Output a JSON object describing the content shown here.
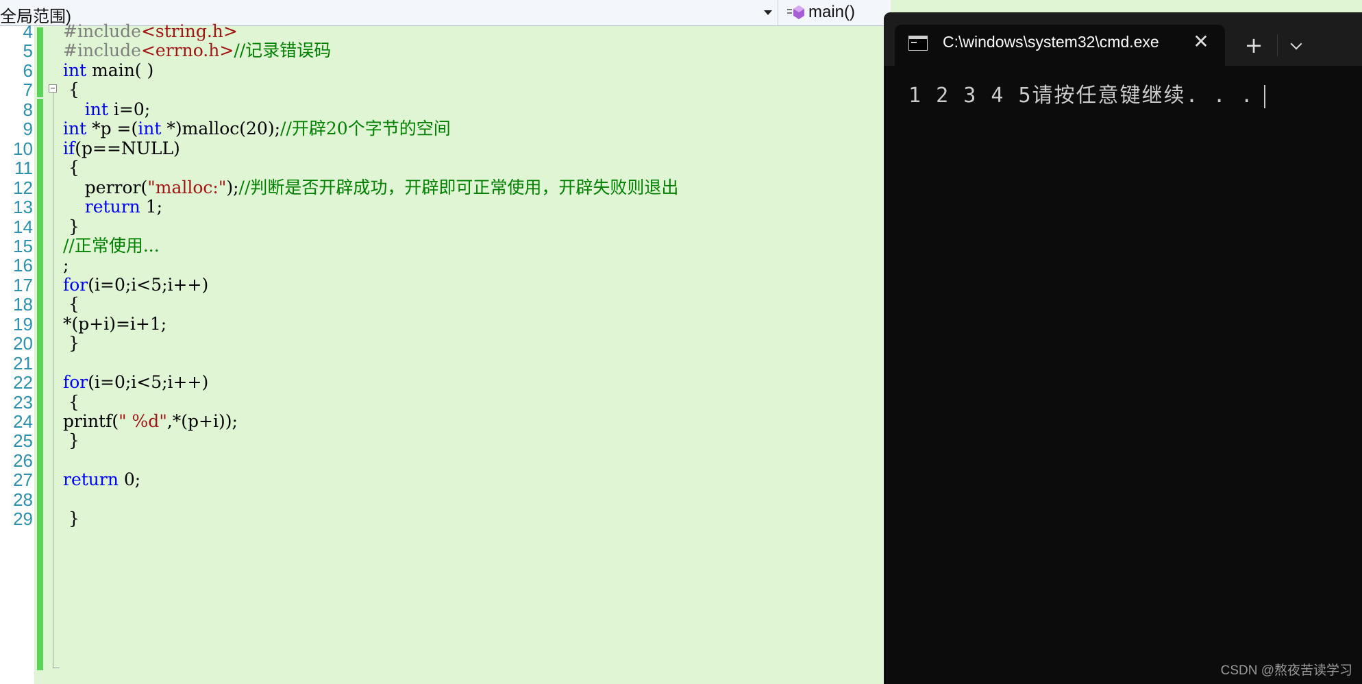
{
  "scope_bar": {
    "scope_text": "全局范围)",
    "member_text": "main()"
  },
  "editor": {
    "lines": [
      {
        "n": "4",
        "parts": [
          [
            "pp",
            "#include"
          ],
          [
            "str",
            "<string.h>"
          ]
        ]
      },
      {
        "n": "5",
        "parts": [
          [
            "pp",
            "#include"
          ],
          [
            "str",
            "<errno.h>"
          ],
          [
            "cm",
            "//记录错误码"
          ]
        ]
      },
      {
        "n": "6",
        "parts": [
          [
            "kw",
            "int"
          ],
          [
            "t",
            " main( )"
          ]
        ]
      },
      {
        "n": "7",
        "parts": [
          [
            "t",
            " {"
          ]
        ]
      },
      {
        "n": "8",
        "parts": [
          [
            "t",
            "    "
          ],
          [
            "kw",
            "int"
          ],
          [
            "t",
            " i=0;"
          ]
        ]
      },
      {
        "n": "9",
        "parts": [
          [
            "kw",
            "int"
          ],
          [
            "t",
            " *p =("
          ],
          [
            "kw",
            "int"
          ],
          [
            "t",
            " *)malloc(20);"
          ],
          [
            "cm",
            "//开辟20个字节的空间"
          ]
        ]
      },
      {
        "n": "10",
        "parts": [
          [
            "kw",
            "if"
          ],
          [
            "t",
            "(p==NULL)"
          ]
        ]
      },
      {
        "n": "11",
        "parts": [
          [
            "t",
            " {"
          ]
        ]
      },
      {
        "n": "12",
        "parts": [
          [
            "t",
            "    perror("
          ],
          [
            "str",
            "\"malloc:\""
          ],
          [
            "t",
            ");"
          ],
          [
            "cm",
            "//判断是否开辟成功，开辟即可正常使用，开辟失败则退出"
          ]
        ]
      },
      {
        "n": "13",
        "parts": [
          [
            "t",
            "    "
          ],
          [
            "kw",
            "return"
          ],
          [
            "t",
            " 1;"
          ]
        ]
      },
      {
        "n": "14",
        "parts": [
          [
            "t",
            " }"
          ]
        ]
      },
      {
        "n": "15",
        "parts": [
          [
            "cm",
            "//正常使用..."
          ]
        ]
      },
      {
        "n": "16",
        "parts": [
          [
            "t",
            ";"
          ]
        ]
      },
      {
        "n": "17",
        "parts": [
          [
            "kw",
            "for"
          ],
          [
            "t",
            "(i=0;i<5;i++)"
          ]
        ]
      },
      {
        "n": "18",
        "parts": [
          [
            "t",
            " {"
          ]
        ]
      },
      {
        "n": "19",
        "parts": [
          [
            "t",
            "*(p+i)=i+1;"
          ]
        ]
      },
      {
        "n": "20",
        "parts": [
          [
            "t",
            " }"
          ]
        ]
      },
      {
        "n": "21",
        "parts": []
      },
      {
        "n": "22",
        "parts": [
          [
            "kw",
            "for"
          ],
          [
            "t",
            "(i=0;i<5;i++)"
          ]
        ]
      },
      {
        "n": "23",
        "parts": [
          [
            "t",
            " {"
          ]
        ]
      },
      {
        "n": "24",
        "parts": [
          [
            "t",
            "printf("
          ],
          [
            "str",
            "\" %d\""
          ],
          [
            "t",
            ",*(p+i));"
          ]
        ]
      },
      {
        "n": "25",
        "parts": [
          [
            "t",
            " }"
          ]
        ]
      },
      {
        "n": "26",
        "parts": []
      },
      {
        "n": "27",
        "parts": [
          [
            "kw",
            "return"
          ],
          [
            "t",
            " 0;"
          ]
        ]
      },
      {
        "n": "28",
        "parts": []
      },
      {
        "n": "29",
        "parts": [
          [
            "t",
            " }"
          ]
        ]
      }
    ]
  },
  "terminal": {
    "tab_title": "C:\\windows\\system32\\cmd.exe",
    "close_glyph": "✕",
    "new_tab_glyph": "+",
    "output": "1 2 3 4 5请按任意键继续. . ."
  },
  "watermark": "CSDN @熬夜苦读学习",
  "colors": {
    "editor_bg": "#dff5d3",
    "keyword": "#0000ff",
    "string": "#a31515",
    "comment": "#008000",
    "line_number": "#2b91af",
    "change_bar": "#5bd35b",
    "terminal_bg": "#0c0c0c"
  }
}
